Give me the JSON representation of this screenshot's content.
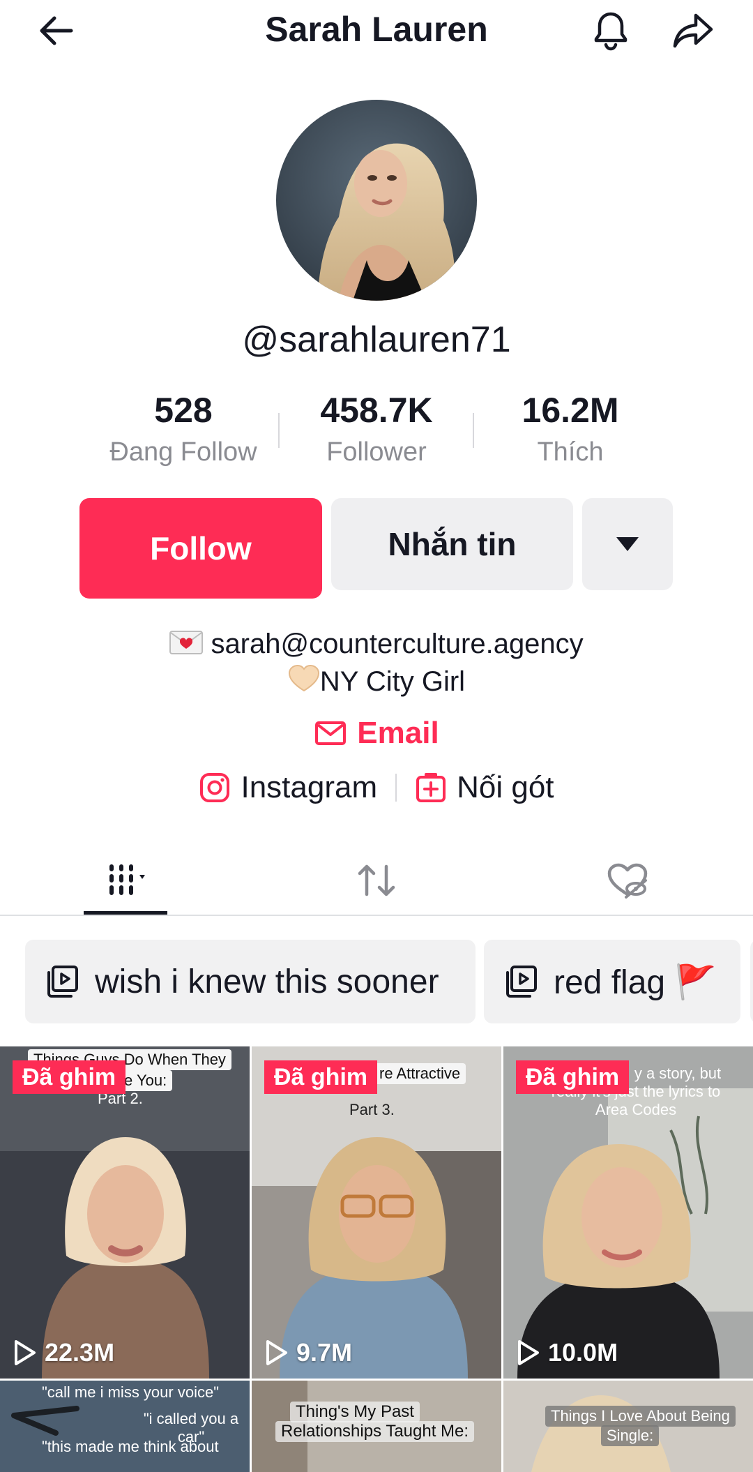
{
  "header": {
    "title": "Sarah Lauren",
    "icons": {
      "back": "arrow-left-icon",
      "bell": "bell-icon",
      "share": "share-icon"
    }
  },
  "profile": {
    "handle": "@sarahlauren71",
    "stats": [
      {
        "value": "528",
        "label": "Đang Follow"
      },
      {
        "value": "458.7K",
        "label": "Follower"
      },
      {
        "value": "16.2M",
        "label": "Thích"
      }
    ],
    "buttons": {
      "follow": "Follow",
      "message": "Nhắn tin"
    },
    "bio": [
      "sarah@counterculture.agency",
      "NY City Girl"
    ],
    "email_link": "Email",
    "links": {
      "instagram": "Instagram",
      "add": "Nối gót"
    }
  },
  "colors": {
    "accent": "#fe2c55",
    "text": "#161823",
    "muted": "#8a8b91",
    "chip_bg": "#f1f1f2"
  },
  "tabs": [
    {
      "icon": "grid-icon",
      "active": true
    },
    {
      "icon": "repost-icon",
      "active": false
    },
    {
      "icon": "liked-hidden-icon",
      "active": false
    }
  ],
  "playlists": [
    {
      "label": "wish i knew this sooner"
    },
    {
      "label": "red flag 🚩"
    }
  ],
  "videos": [
    {
      "pinned": "Đã ghim",
      "views": "22.3M",
      "caption_lines": [
        "Things Guys Do When They",
        "e You:",
        "Part 2."
      ]
    },
    {
      "pinned": "Đã ghim",
      "views": "9.7M",
      "caption_lines": [
        "re Attractive",
        "Part 3."
      ]
    },
    {
      "pinned": "Đã ghim",
      "views": "10.0M",
      "caption_lines": [
        "y a story, but",
        "really it's just the lyrics to",
        "Area Codes"
      ]
    },
    {
      "caption_lines": [
        "\"call me i miss your voice\"",
        "\"i called you a car\"",
        "\"this made me think about"
      ]
    },
    {
      "caption_lines": [
        "Thing's My Past",
        "Relationships Taught Me:"
      ]
    },
    {
      "caption_lines": [
        "Things I Love About Being",
        "Single:"
      ]
    }
  ]
}
